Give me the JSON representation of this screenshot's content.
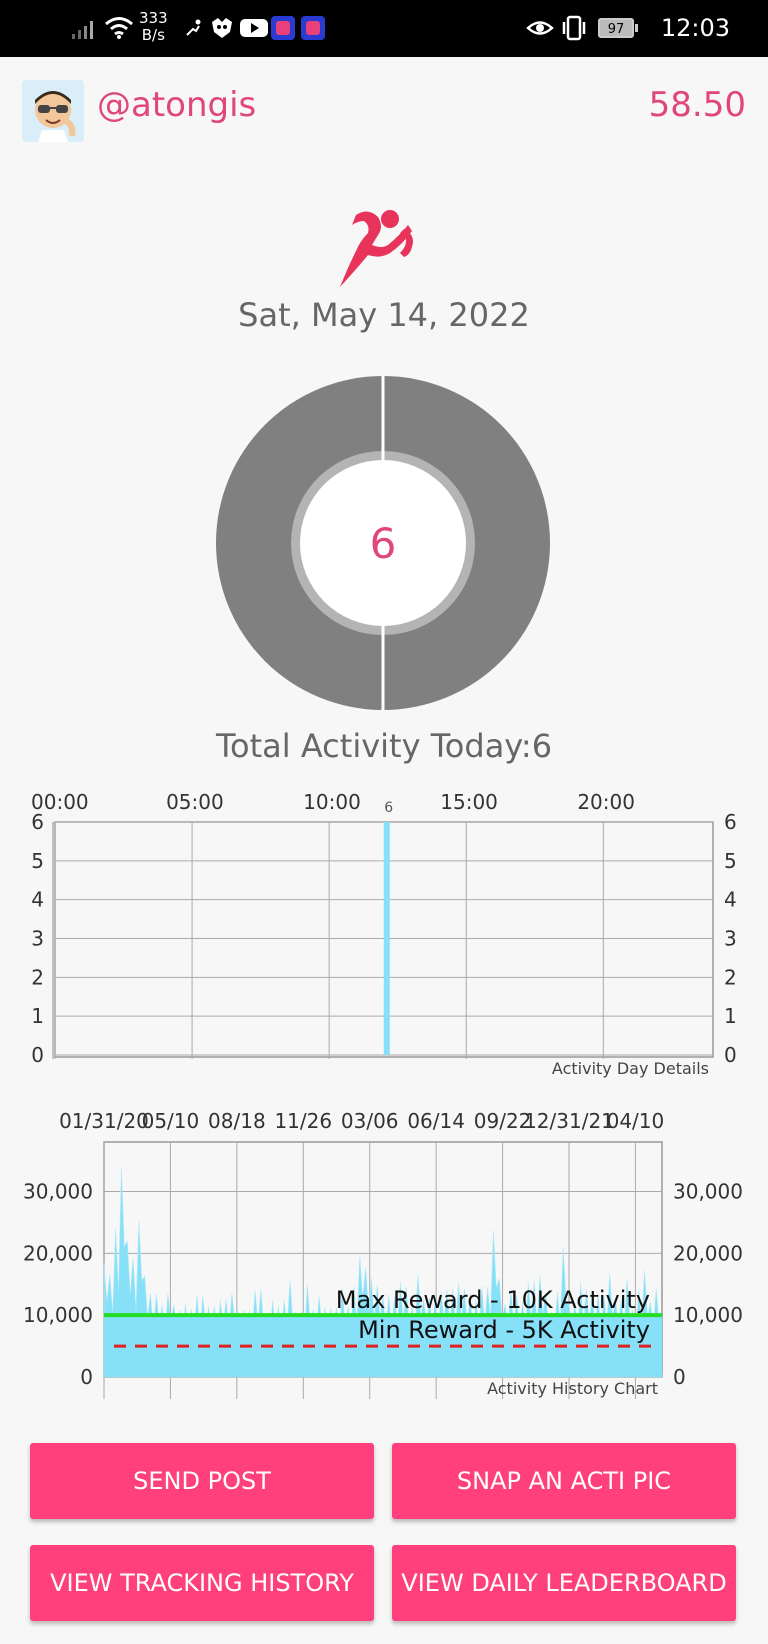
{
  "status_bar": {
    "speed_value": "333",
    "speed_unit": "B/s",
    "battery": "97",
    "time": "12:03"
  },
  "header": {
    "username": "@atongis",
    "balance": "58.50"
  },
  "date": "Sat, May 14, 2022",
  "donut": {
    "value": "6"
  },
  "total_activity": "Total Activity Today:6",
  "colors": {
    "accent": "#e0457b",
    "button": "#ff407c",
    "bar": "#86e0f7",
    "donut": "#808080",
    "max_line": "#22dd22",
    "min_line": "#dd2222"
  },
  "chart_data": [
    {
      "type": "bar",
      "xlabel": "",
      "ylabel": "",
      "x_ticks": [
        "00:00",
        "05:00",
        "10:00",
        "15:00",
        "20:00"
      ],
      "y_ticks": [
        "0",
        "1",
        "2",
        "3",
        "4",
        "5",
        "6"
      ],
      "ylim": [
        0,
        6
      ],
      "xlim_hours": [
        0,
        24
      ],
      "bars": [
        {
          "hour": 12.1,
          "value": 6,
          "label": "6"
        }
      ],
      "annotation": "Activity Day Details",
      "grid": true
    },
    {
      "type": "area",
      "xlabel": "",
      "ylabel": "",
      "x_ticks": [
        "01/31/20",
        "05/10",
        "08/18",
        "11/26",
        "03/06",
        "06/14",
        "09/22",
        "12/31/21",
        "04/10"
      ],
      "y_ticks": [
        "0",
        "10,000",
        "20,000",
        "30,000"
      ],
      "ylim": [
        0,
        38000
      ],
      "series_profile": [
        20000,
        17000,
        23000,
        35000,
        22000,
        18000,
        26000,
        16000,
        12000,
        14000,
        11000,
        15000,
        12000,
        10000,
        13000,
        11000,
        12000,
        14000,
        11000,
        10000,
        13000,
        12000,
        15000,
        11000,
        10000,
        12000,
        14000,
        13000,
        11000,
        12000,
        10000,
        13000,
        15000,
        12000,
        11000,
        14000,
        12000,
        13000,
        10000,
        12000,
        11000,
        13000,
        12000,
        14000,
        21000,
        18000,
        15000,
        16000,
        13000,
        12000,
        14000,
        15000,
        13000,
        12000,
        16000,
        14000,
        13000,
        12000,
        15000,
        14000,
        13000,
        16000,
        14000,
        12000,
        13000,
        14000,
        16000,
        24000,
        15000,
        13000,
        14000,
        12000,
        13000,
        15000,
        14000,
        17000,
        13000,
        12000,
        14000,
        20000,
        13000,
        12000,
        14000,
        15000,
        13000,
        12000,
        14000,
        16000,
        14000,
        13000,
        15000,
        12000,
        14000,
        16000,
        13000,
        14000
      ],
      "lines": [
        {
          "name": "Max Reward - 10K Activity",
          "value": 10000,
          "style": "solid"
        },
        {
          "name": "Min Reward - 5K Activity",
          "value": 5000,
          "style": "dashed"
        }
      ],
      "annotation": "Activity History Chart",
      "grid": true
    }
  ],
  "buttons": {
    "send_post": "SEND POST",
    "snap_pic": "SNAP AN ACTI PIC",
    "tracking_history": "VIEW TRACKING HISTORY",
    "leaderboard": "VIEW DAILY LEADERBOARD"
  }
}
